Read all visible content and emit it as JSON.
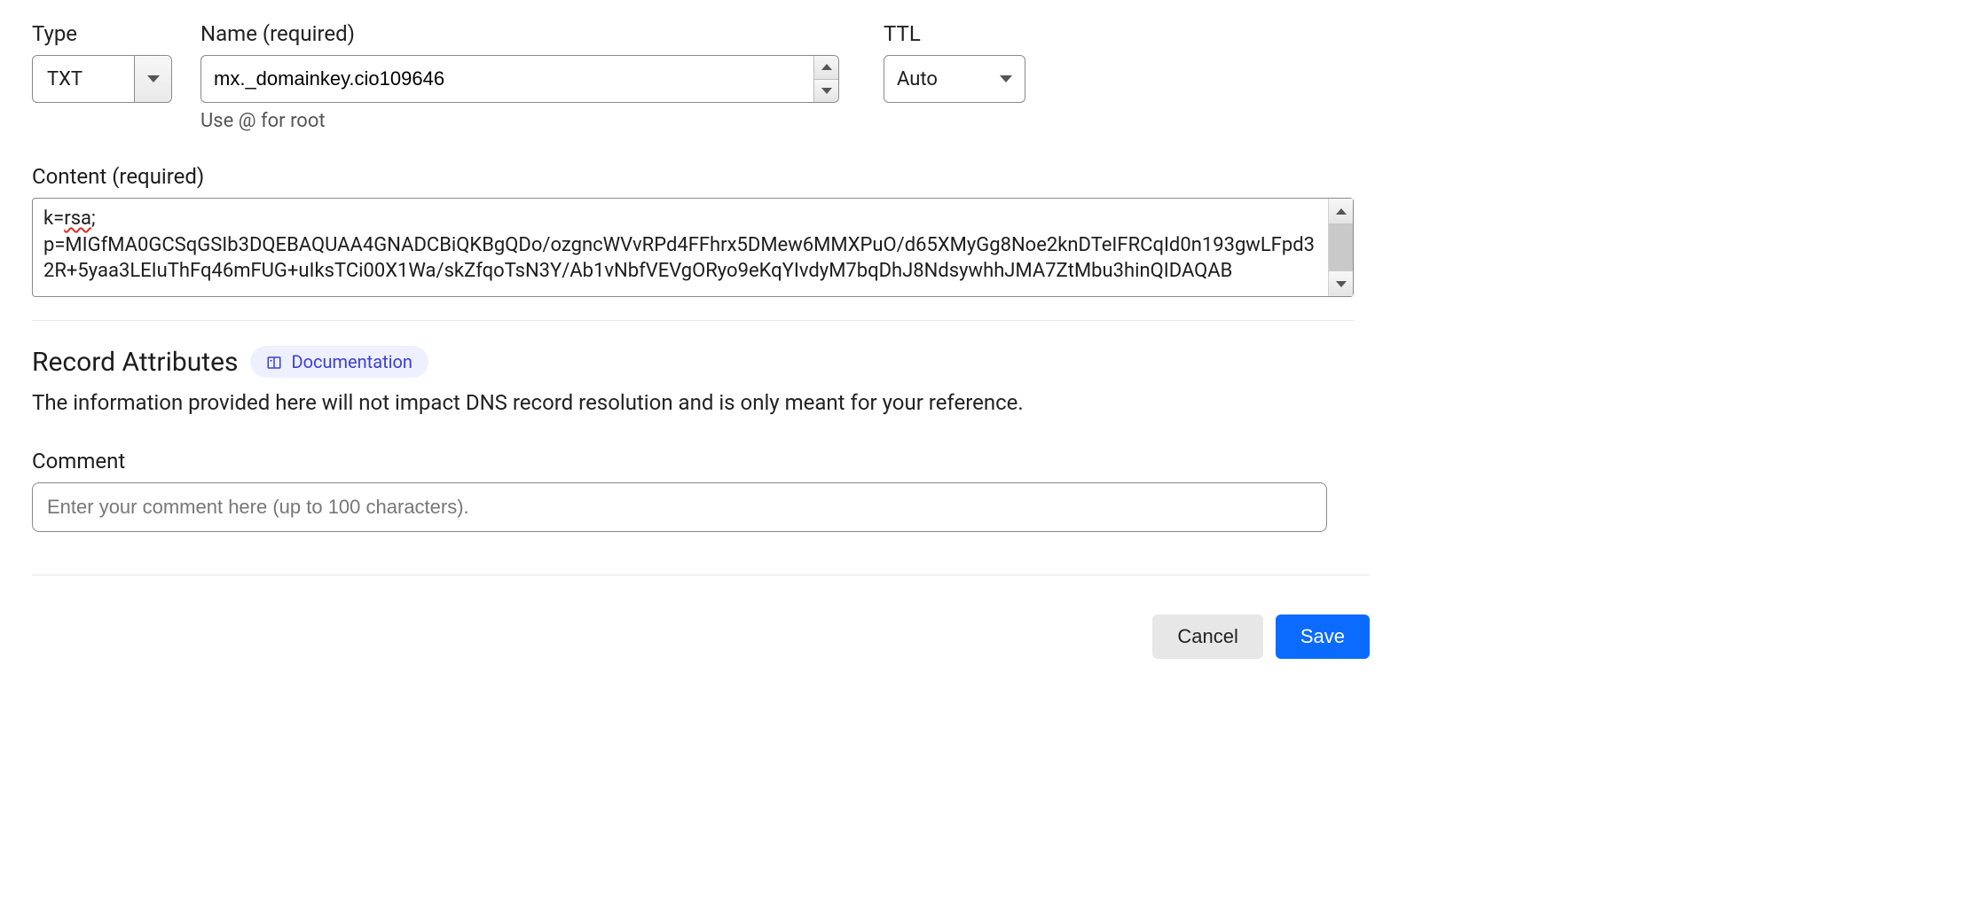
{
  "labels": {
    "type": "Type",
    "name": "Name (required)",
    "name_hint": "Use @ for root",
    "ttl": "TTL",
    "content": "Content (required)",
    "attrs_title": "Record Attributes",
    "documentation": "Documentation",
    "attrs_desc": "The information provided here will not impact DNS record resolution and is only meant for your reference.",
    "comment": "Comment",
    "comment_placeholder": "Enter your comment here (up to 100 characters).",
    "cancel": "Cancel",
    "save": "Save"
  },
  "values": {
    "type": "TXT",
    "name": "mx._domainkey.cio109646",
    "ttl": "Auto",
    "content_prefix": "k=",
    "content_spellcheck": "rsa",
    "content_after_spellcheck": ";",
    "content_rest": "p=MIGfMA0GCSqGSIb3DQEBAQUAA4GNADCBiQKBgQDo/ozgncWVvRPd4FFhrx5DMew6MMXPuO/d65XMyGg8Noe2knDTeIFRCqId0n193gwLFpd32R+5yaa3LEIuThFq46mFUG+uIksTCi00X1Wa/skZfqoTsN3Y/Ab1vNbfVEVgORyo9eKqYIvdyM7bqDhJ8NdsywhhJMA7ZtMbu3hinQIDAQAB"
  }
}
